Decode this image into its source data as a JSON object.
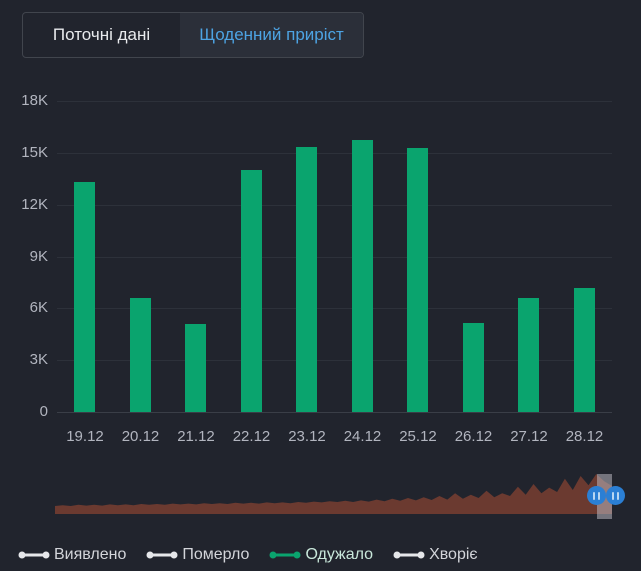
{
  "colors": {
    "background": "#21242d",
    "accent_blue": "#4da3e3",
    "tab_text": "#e8eaed",
    "tab_border": "#41454d",
    "tab_active_bg": "#2b2f39",
    "axis_text": "#b2b5bf",
    "gridline": "#2d313a",
    "zero_line": "#3a3e47",
    "bar_green": "#0aa46e",
    "navigator_fill": "#6b3a30",
    "range_strip": "rgba(186,183,192,0.55)",
    "handle_blue": "#2b7fd4",
    "handle_bar": "#b9d7f2",
    "legend_text": "#d3d5da",
    "legend_active_text": "#c9e8db",
    "legend_inactive_marker": "#e6e7ea"
  },
  "tabs": [
    {
      "label": "Поточні дані",
      "active": false
    },
    {
      "label": "Щоденний приріст",
      "active": true
    }
  ],
  "chart_data": {
    "type": "bar",
    "title": "",
    "xlabel": "",
    "ylabel": "",
    "categories": [
      "19.12",
      "20.12",
      "21.12",
      "22.12",
      "23.12",
      "24.12",
      "25.12",
      "26.12",
      "27.12",
      "28.12"
    ],
    "series": [
      {
        "name": "Одужало",
        "color": "#0aa46e",
        "values": [
          13300,
          6600,
          5100,
          14000,
          15350,
          15750,
          15300,
          5150,
          6600,
          7150
        ]
      }
    ],
    "ylim": [
      0,
      18000
    ],
    "yticks": [
      "0",
      "3K",
      "6K",
      "9K",
      "12K",
      "15K",
      "18K"
    ],
    "grid": true,
    "legend_position": "bottom"
  },
  "legend": [
    {
      "label": "Виявлено",
      "active": false
    },
    {
      "label": "Померло",
      "active": false
    },
    {
      "label": "Одужало",
      "active": true
    },
    {
      "label": "Хворіє",
      "active": false
    }
  ],
  "navigator": {
    "description": "full-history area preview with selected range at right edge",
    "values": [
      0.2,
      0.22,
      0.2,
      0.23,
      0.21,
      0.23,
      0.21,
      0.24,
      0.22,
      0.24,
      0.22,
      0.25,
      0.23,
      0.25,
      0.23,
      0.26,
      0.24,
      0.26,
      0.24,
      0.27,
      0.25,
      0.27,
      0.25,
      0.28,
      0.26,
      0.28,
      0.26,
      0.29,
      0.27,
      0.29,
      0.27,
      0.3,
      0.28,
      0.31,
      0.29,
      0.32,
      0.3,
      0.33,
      0.3,
      0.34,
      0.31,
      0.36,
      0.32,
      0.38,
      0.33,
      0.4,
      0.34,
      0.42,
      0.35,
      0.45,
      0.36,
      0.52,
      0.38,
      0.48,
      0.4,
      0.58,
      0.42,
      0.52,
      0.45,
      0.68,
      0.48,
      0.75,
      0.52,
      0.66,
      0.55,
      0.88,
      0.6,
      0.95,
      0.72,
      1.0,
      0.82,
      0.7
    ]
  }
}
